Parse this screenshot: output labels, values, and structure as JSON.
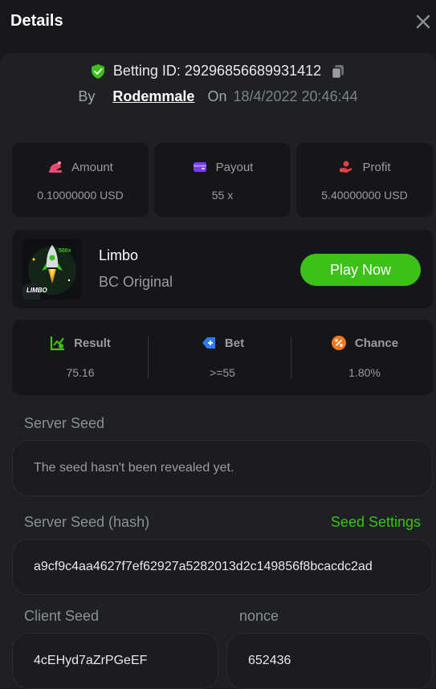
{
  "header": {
    "title": "Details",
    "close_icon": "close-icon"
  },
  "bet": {
    "betting_id_label": "Betting ID:",
    "betting_id": "29296856689931412",
    "by_label": "By",
    "user": "Rodemmale",
    "on_label": "On",
    "datetime": "18/4/2022 20:46:44"
  },
  "stats": [
    {
      "label": "Amount",
      "value": "0.10000000 USD",
      "icon": "coins-icon"
    },
    {
      "label": "Payout",
      "value": "55 x",
      "icon": "wallet-icon"
    },
    {
      "label": "Profit",
      "value": "5.40000000 USD",
      "icon": "profit-hand-icon"
    }
  ],
  "game": {
    "name": "Limbo",
    "subtitle": "BC Original",
    "thumb_text": "LIMBO",
    "thumb_multiplier": "500x",
    "play_label": "Play Now"
  },
  "result_bar": [
    {
      "label": "Result",
      "value": "75.16",
      "icon": "result-chart-icon"
    },
    {
      "label": "Bet",
      "value": ">=55",
      "icon": "bet-tag-icon"
    },
    {
      "label": "Chance",
      "value": "1.80%",
      "icon": "percent-icon"
    }
  ],
  "server_seed": {
    "label": "Server Seed",
    "value": "The seed hasn't been revealed yet."
  },
  "server_seed_hash": {
    "label": "Server Seed (hash)",
    "settings_link": "Seed Settings",
    "value": "a9cf9c4aa4627f7ef62927a5282013d2c149856f8bcacdc2ad"
  },
  "client_seed": {
    "label": "Client Seed",
    "value": "4cEHyd7aZrPGeEF"
  },
  "nonce": {
    "label": "nonce",
    "value": "652436"
  },
  "colors": {
    "accent_green": "#3bc117",
    "amount_icon": "#e84a6e",
    "payout_icon": "#7a3cf0",
    "profit_icon": "#e8403b",
    "bet_icon": "#2d7bf0",
    "chance_icon": "#f07820"
  }
}
